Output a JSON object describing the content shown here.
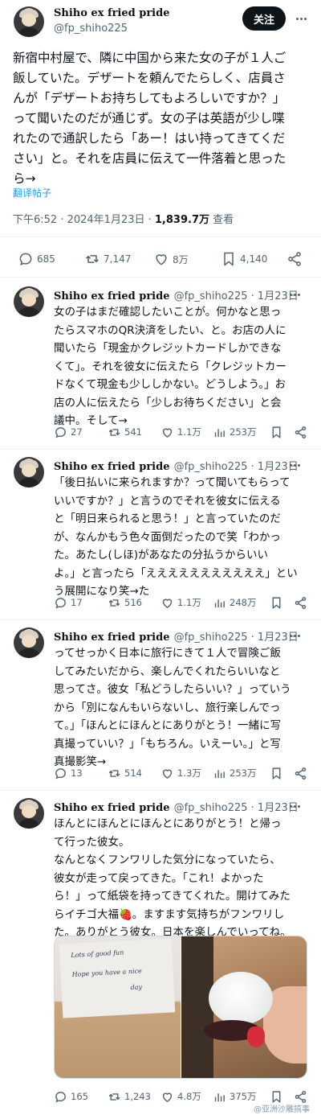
{
  "main_tweet": {
    "author_name": "Shiho ex fried pride",
    "author_handle": "@fp_shiho225",
    "follow_label": "关注",
    "text": "新宿中村屋で、隣に中国から来た女の子が１人ご\n飯していた。デザートを頼んでたらしく、店員さ\nんが「デザートお持ちしてもよろしいですか？」\nって聞いたのだが通じず。女の子は英語が少し喋\nれたので通訳したら「あー！はい持ってきてくだ\nさい」と。それを店員に伝えて一件落着と思った\nら→",
    "translate_label": "翻译帖子",
    "time": "下午6:52 · 2024年1月23日 · ",
    "views": "1,839.7万",
    "views_suffix": " 查看",
    "stats": {
      "replies": "685",
      "retweets": "7,147",
      "likes": "8万",
      "bookmarks": "4,140"
    }
  },
  "replies": [
    {
      "name": "Shiho ex fried pride",
      "handle_date": "@fp_shiho225 · 1月23日",
      "text": "女の子はまだ確認したいことが。何かなと思っ\nたらスマホのQR決済をしたい、と。お店の人に\n聞いたら「現金かクレジットカードしかできな\nくて」。それを彼女に伝えたら「クレジットカー\nドなくて現金も少ししかない。どうしよう。」お\n店の人に伝えたら「少しお待ちください」と会\n議中。そして→",
      "stats": {
        "replies": "27",
        "retweets": "541",
        "likes": "1.1万",
        "views": "253万"
      }
    },
    {
      "name": "Shiho ex fried pride",
      "handle_date": "@fp_shiho225 · 1月23日",
      "text": "「後日払いに来られますか？って聞いてもらって\nいいですか？」と言うのでそれを彼女に伝える\nと「明日来られると思う！」と言っていたのだ\nが、なんかもう色々面倒だったので笑「わかっ\nた。あたし(しほ)があなたの分払うからいい\nよ。」と言ったら「えええええええええええ」とい\nう展開になり笑→た",
      "stats": {
        "replies": "17",
        "retweets": "516",
        "likes": "1.1万",
        "views": "248万"
      }
    },
    {
      "name": "Shiho ex fried pride",
      "handle_date": "@fp_shiho225 · 1月23日",
      "text": "ってせっかく日本に旅行にきて１人で冒険ご飯\nしてみたいだから、楽しんでくれたらいいなと\n思ってさ。彼女「私どうしたらいい？」っていう\nから「別になんもいらないし、旅行楽しんでっ\nて。」「ほんとにほんとにありがとう！一緒に写\n真撮っていい？」「もちろん。いえーい。」と写\n真撮影笑→",
      "stats": {
        "replies": "13",
        "retweets": "514",
        "likes": "1.3万",
        "views": "253万"
      }
    },
    {
      "name": "Shiho ex fried pride",
      "handle_date": "@fp_shiho225 · 1月23日",
      "text": "ほんとにほんとにほんとにありがとう！と帰っ\nて行った彼女。\nなんとなくフンワリした気分になっていたら、\n彼女が走って戻ってきた。「これ！よかった\nら！」って紙袋を持ってきてくれた。開けてみた\nらイチゴ大福🍓。ますます気持ちがフンワリし\nた。ありがとう彼女。日本を楽しんでいってね。",
      "photo_note": [
        "Lots of good fun",
        "Hope you have a nice",
        "day"
      ],
      "stats": {
        "replies": "165",
        "retweets": "1,243",
        "likes": "4.8万",
        "views": "375万"
      }
    }
  ],
  "watermark": "@亚洲沙雕搞事",
  "colors": {
    "text": "#0f1419",
    "secondary": "#536471",
    "link": "#1d9bf0",
    "divider": "#eff3f4"
  }
}
